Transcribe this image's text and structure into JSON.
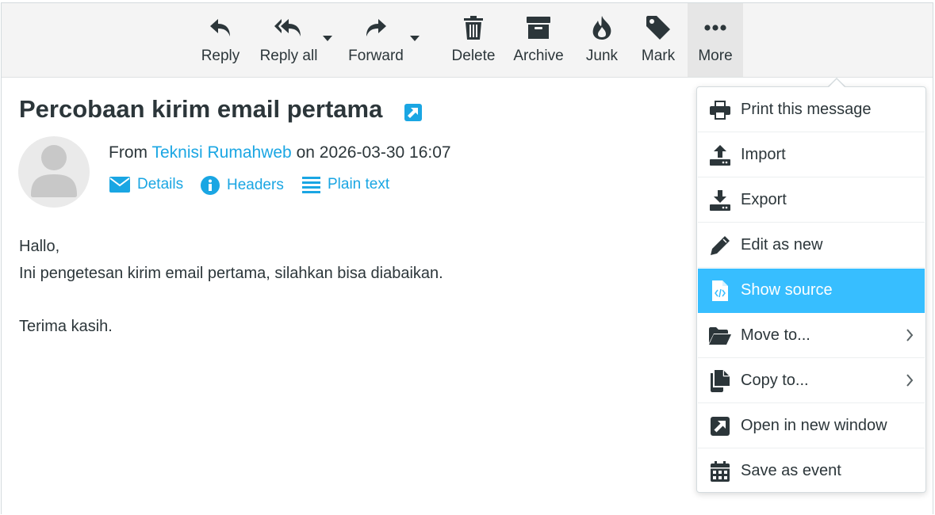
{
  "toolbar": {
    "reply": "Reply",
    "reply_all": "Reply all",
    "forward": "Forward",
    "delete": "Delete",
    "archive": "Archive",
    "junk": "Junk",
    "mark": "Mark",
    "more": "More"
  },
  "message": {
    "subject": "Percobaan kirim email pertama",
    "from_prefix": "From",
    "from_name": "Teknisi Rumahweb",
    "on_text": "on",
    "date": "2026-03-30 16:07",
    "links": {
      "details": "Details",
      "headers": "Headers",
      "plain_text": "Plain text"
    },
    "body": [
      "Hallo,",
      "Ini pengetesan kirim email pertama, silahkan bisa diabaikan.",
      "",
      "Terima kasih."
    ]
  },
  "menu": {
    "items": [
      {
        "label": "Print this message",
        "icon": "printer-icon"
      },
      {
        "label": "Import",
        "icon": "upload-icon"
      },
      {
        "label": "Export",
        "icon": "download-icon"
      },
      {
        "label": "Edit as new",
        "icon": "pencil-icon"
      },
      {
        "label": "Show source",
        "icon": "code-file-icon",
        "selected": true
      },
      {
        "label": "Move to...",
        "icon": "folder-open-icon",
        "submenu": true
      },
      {
        "label": "Copy to...",
        "icon": "copy-icon",
        "submenu": true
      },
      {
        "label": "Open in new window",
        "icon": "external-window-icon"
      },
      {
        "label": "Save as event",
        "icon": "calendar-icon"
      }
    ]
  },
  "colors": {
    "text": "#2c363a",
    "link": "#1aa6e3",
    "selected_bg": "#37beff",
    "toolbar_bg": "#f4f4f4"
  }
}
